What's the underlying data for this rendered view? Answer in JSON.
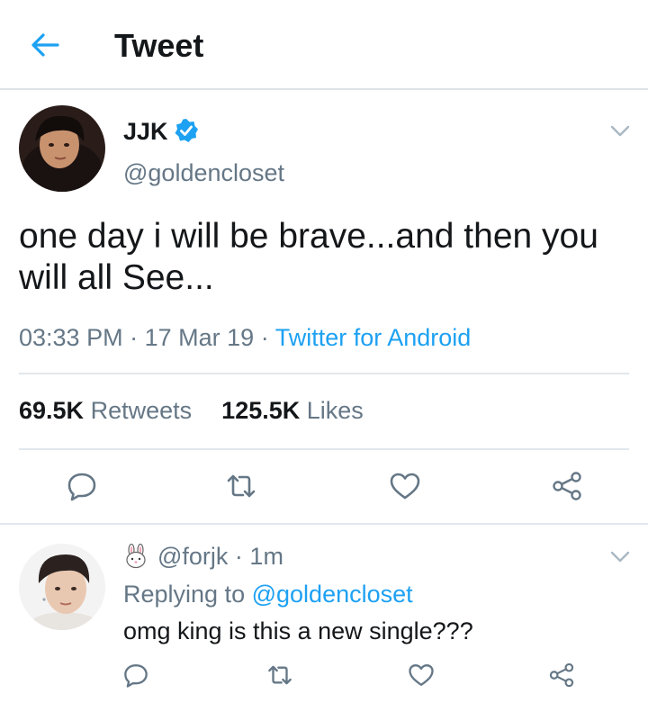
{
  "header": {
    "title": "Tweet"
  },
  "tweet": {
    "name": "JJK",
    "handle": "@goldencloset",
    "text": "one day i will be brave...and then you will all See...",
    "time": "03:33 PM",
    "date": "17 Mar 19",
    "source": "Twitter for Android",
    "retweets_count": "69.5K",
    "retweets_label": "Retweets",
    "likes_count": "125.5K",
    "likes_label": "Likes"
  },
  "reply": {
    "handle": "@forjk",
    "time": "1m",
    "replying_prefix": "Replying to",
    "replying_to": "@goldencloset",
    "text": "omg king is this a new single???"
  },
  "colors": {
    "accent": "#1da1f2",
    "muted": "#657786",
    "text": "#14171a",
    "divider": "#e1e8ed"
  },
  "icons": [
    "back-arrow-icon",
    "verified-badge-icon",
    "chevron-down-icon",
    "reply-icon",
    "retweet-icon",
    "like-icon",
    "share-icon",
    "bunny-emoji-icon"
  ]
}
